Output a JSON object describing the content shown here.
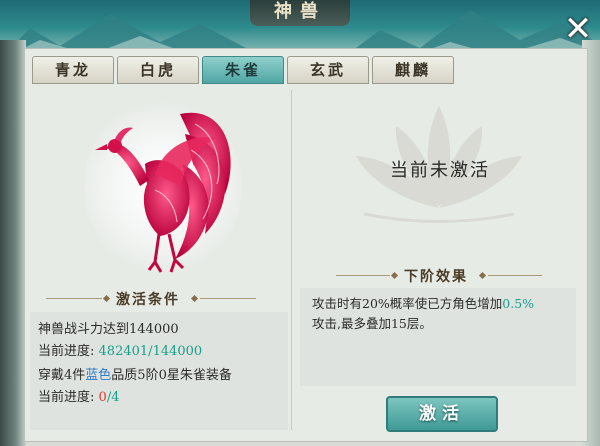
{
  "window": {
    "title": "神兽",
    "close_icon": "close-x-icon"
  },
  "tabs": [
    {
      "label": "青龙",
      "active": false
    },
    {
      "label": "白虎",
      "active": false
    },
    {
      "label": "朱雀",
      "active": true
    },
    {
      "label": "玄武",
      "active": false
    },
    {
      "label": "麒麟",
      "active": false
    }
  ],
  "beast": {
    "illustration": "phoenix-icon",
    "color": "#e0235a"
  },
  "activation": {
    "title": "激活条件",
    "req1": {
      "prefix": "神兽战斗力达到",
      "value": "144000"
    },
    "progress1": {
      "label": "当前进度:",
      "current": "482401",
      "sep": "/",
      "target": "144000"
    },
    "req2": {
      "prefix": "穿戴4件",
      "quality": "蓝色",
      "suffix": "品质5阶0星朱雀装备"
    },
    "progress2": {
      "label": "当前进度:",
      "current": "0",
      "sep": "/",
      "target": "4"
    }
  },
  "status": {
    "text": "当前未激活"
  },
  "next_effect": {
    "title": "下阶效果",
    "line1_prefix": "攻击时有20%概率使已方角色增加",
    "line1_value": "0.5%",
    "line2": "攻击,最多叠加15层。"
  },
  "buttons": {
    "activate": "激活"
  },
  "colors": {
    "accent_teal": "#4fa6a4",
    "progress_green": "#16a08a",
    "progress_red": "#e03a2c",
    "quality_blue": "#2f7ac7"
  }
}
